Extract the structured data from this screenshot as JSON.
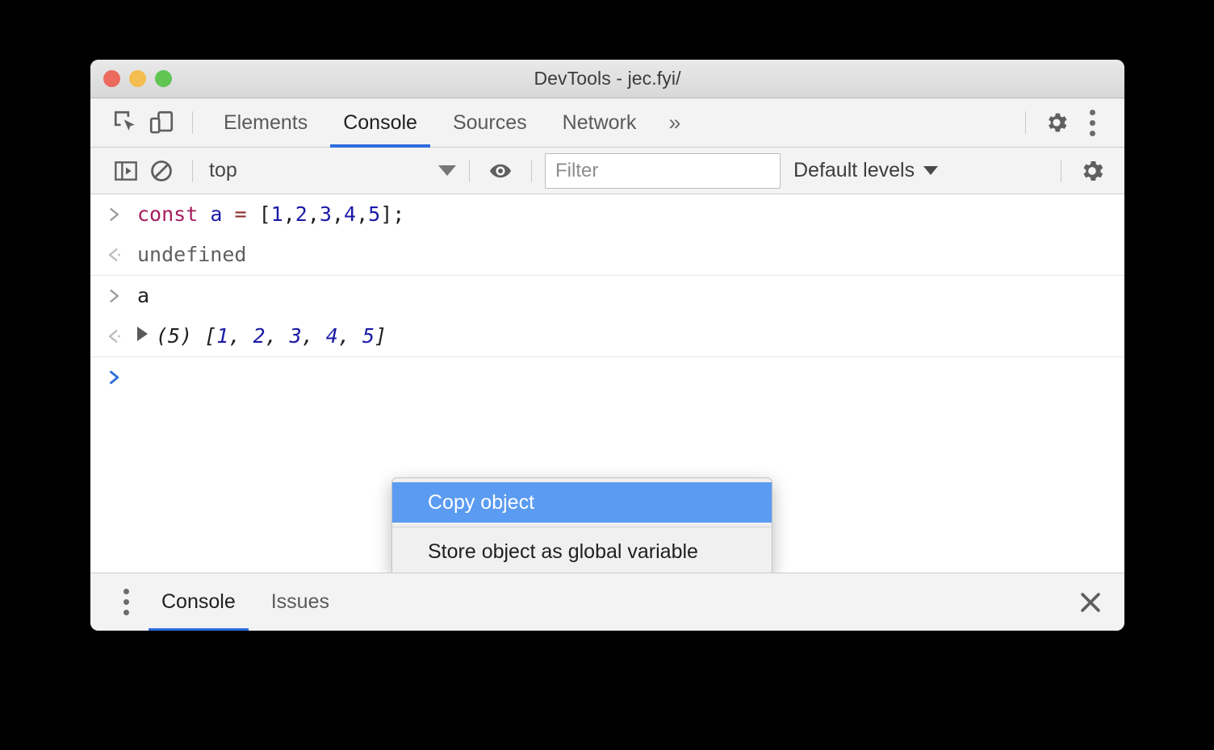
{
  "window": {
    "title": "DevTools - jec.fyi/",
    "traffic_lights": [
      "close",
      "minimize",
      "zoom"
    ]
  },
  "main_toolbar": {
    "inspect_icon": "inspect-cursor-icon",
    "device_icon": "device-toolbar-icon",
    "tabs": [
      {
        "label": "Elements",
        "active": false
      },
      {
        "label": "Console",
        "active": true
      },
      {
        "label": "Sources",
        "active": false
      },
      {
        "label": "Network",
        "active": false
      }
    ],
    "more_tabs_label": "»",
    "settings_icon": "gear-icon",
    "menu_icon": "kebab-menu-icon",
    "active_tab_underline_color": "#2d6cdf"
  },
  "filter_toolbar": {
    "sidebar_toggle_icon": "console-sidebar-icon",
    "clear_console_icon": "clear-console-icon",
    "context": "top",
    "context_caret": "chevron-down-icon",
    "live_expression_icon": "eye-icon",
    "filter_placeholder": "Filter",
    "filter_value": "",
    "levels_label": "Default levels",
    "levels_caret": "chevron-down-icon",
    "settings_icon": "gear-icon"
  },
  "console": {
    "messages": [
      {
        "kind": "input",
        "gutter": "input-arrow",
        "tokens": [
          {
            "text": "const",
            "type": "keyword"
          },
          {
            "text": " ",
            "type": "plain"
          },
          {
            "text": "a",
            "type": "variable"
          },
          {
            "text": " ",
            "type": "plain"
          },
          {
            "text": "=",
            "type": "operator"
          },
          {
            "text": " ",
            "type": "plain"
          },
          {
            "text": "[",
            "type": "punct"
          },
          {
            "text": "1",
            "type": "number"
          },
          {
            "text": ",",
            "type": "punct"
          },
          {
            "text": "2",
            "type": "number"
          },
          {
            "text": ",",
            "type": "punct"
          },
          {
            "text": "3",
            "type": "number"
          },
          {
            "text": ",",
            "type": "punct"
          },
          {
            "text": "4",
            "type": "number"
          },
          {
            "text": ",",
            "type": "punct"
          },
          {
            "text": "5",
            "type": "number"
          },
          {
            "text": "]",
            "type": "punct"
          },
          {
            "text": ";",
            "type": "punct"
          }
        ],
        "plain": "const a = [1,2,3,4,5];"
      },
      {
        "kind": "result",
        "gutter": "result-arrow",
        "plain": "undefined"
      },
      {
        "kind": "input",
        "gutter": "input-arrow",
        "plain": "a"
      },
      {
        "kind": "result-object",
        "gutter": "result-arrow",
        "disclosure": "disclosure-triangle-collapsed",
        "length_label": "(5)",
        "open_bracket": "[",
        "items": [
          "1",
          "2",
          "3",
          "4",
          "5"
        ],
        "close_bracket": "]",
        "plain": "(5) [1, 2, 3, 4, 5]"
      },
      {
        "kind": "prompt",
        "gutter": "prompt-arrow",
        "plain": ""
      }
    ]
  },
  "context_menu": {
    "items": [
      {
        "label": "Copy object",
        "selected": true
      },
      {
        "label": "Store object as global variable",
        "selected": false
      }
    ],
    "highlight_color": "#5b9bf1"
  },
  "drawer": {
    "menu_icon": "kebab-menu-icon",
    "tabs": [
      {
        "label": "Console",
        "active": true
      },
      {
        "label": "Issues",
        "active": false
      }
    ],
    "close_icon": "close-icon"
  }
}
